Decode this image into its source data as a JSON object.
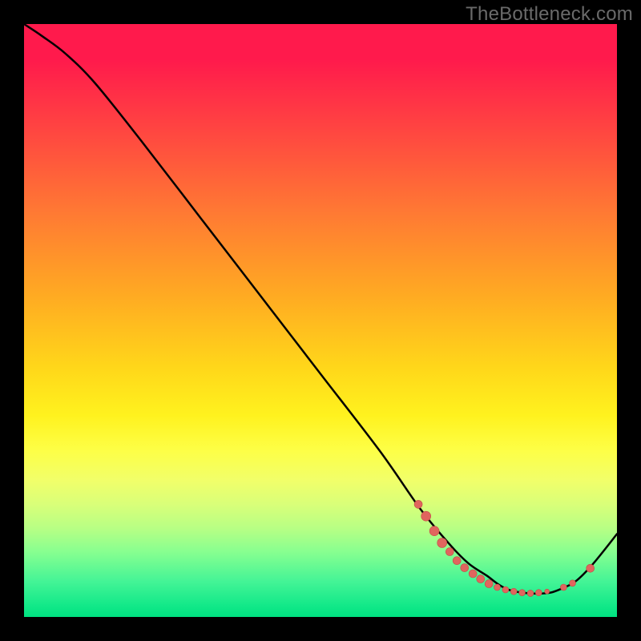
{
  "watermark": "TheBottleneck.com",
  "colors": {
    "curve_stroke": "#000000",
    "marker_fill": "#e0655e",
    "marker_stroke": "#c24b45",
    "bg_top": "#ff1a4c",
    "bg_bottom": "#00e281"
  },
  "chart_data": {
    "type": "line",
    "title": "",
    "xlabel": "",
    "ylabel": "",
    "xlim": [
      0,
      100
    ],
    "ylim": [
      0,
      100
    ],
    "note": "Axes are unlabeled in the image; values are normalized 0–100 estimated from pixel positions. y is plotted with 0 at bottom.",
    "series": [
      {
        "name": "curve",
        "x": [
          0,
          3,
          7,
          12,
          20,
          30,
          40,
          50,
          60,
          67,
          72,
          75,
          78,
          80,
          82,
          85,
          88,
          90,
          93,
          96,
          100
        ],
        "y": [
          100,
          98,
          95,
          90,
          80,
          67,
          54,
          41,
          28,
          18,
          12,
          9,
          7,
          5.5,
          4.5,
          4,
          4,
          4.5,
          6,
          9,
          14
        ]
      }
    ],
    "markers": [
      {
        "x": 66.5,
        "y": 19.0,
        "r": 5
      },
      {
        "x": 67.8,
        "y": 17.0,
        "r": 6
      },
      {
        "x": 69.2,
        "y": 14.5,
        "r": 6
      },
      {
        "x": 70.5,
        "y": 12.5,
        "r": 6
      },
      {
        "x": 71.8,
        "y": 11.0,
        "r": 5
      },
      {
        "x": 73.0,
        "y": 9.5,
        "r": 5
      },
      {
        "x": 74.3,
        "y": 8.3,
        "r": 5
      },
      {
        "x": 75.7,
        "y": 7.3,
        "r": 5
      },
      {
        "x": 77.0,
        "y": 6.4,
        "r": 5
      },
      {
        "x": 78.4,
        "y": 5.6,
        "r": 5
      },
      {
        "x": 79.8,
        "y": 5.0,
        "r": 4
      },
      {
        "x": 81.2,
        "y": 4.6,
        "r": 4
      },
      {
        "x": 82.6,
        "y": 4.3,
        "r": 4
      },
      {
        "x": 84.0,
        "y": 4.1,
        "r": 4
      },
      {
        "x": 85.4,
        "y": 4.0,
        "r": 4
      },
      {
        "x": 86.8,
        "y": 4.1,
        "r": 4
      },
      {
        "x": 88.2,
        "y": 4.3,
        "r": 3
      },
      {
        "x": 91.0,
        "y": 5.0,
        "r": 4
      },
      {
        "x": 92.5,
        "y": 5.7,
        "r": 4
      },
      {
        "x": 95.5,
        "y": 8.2,
        "r": 5
      }
    ]
  }
}
